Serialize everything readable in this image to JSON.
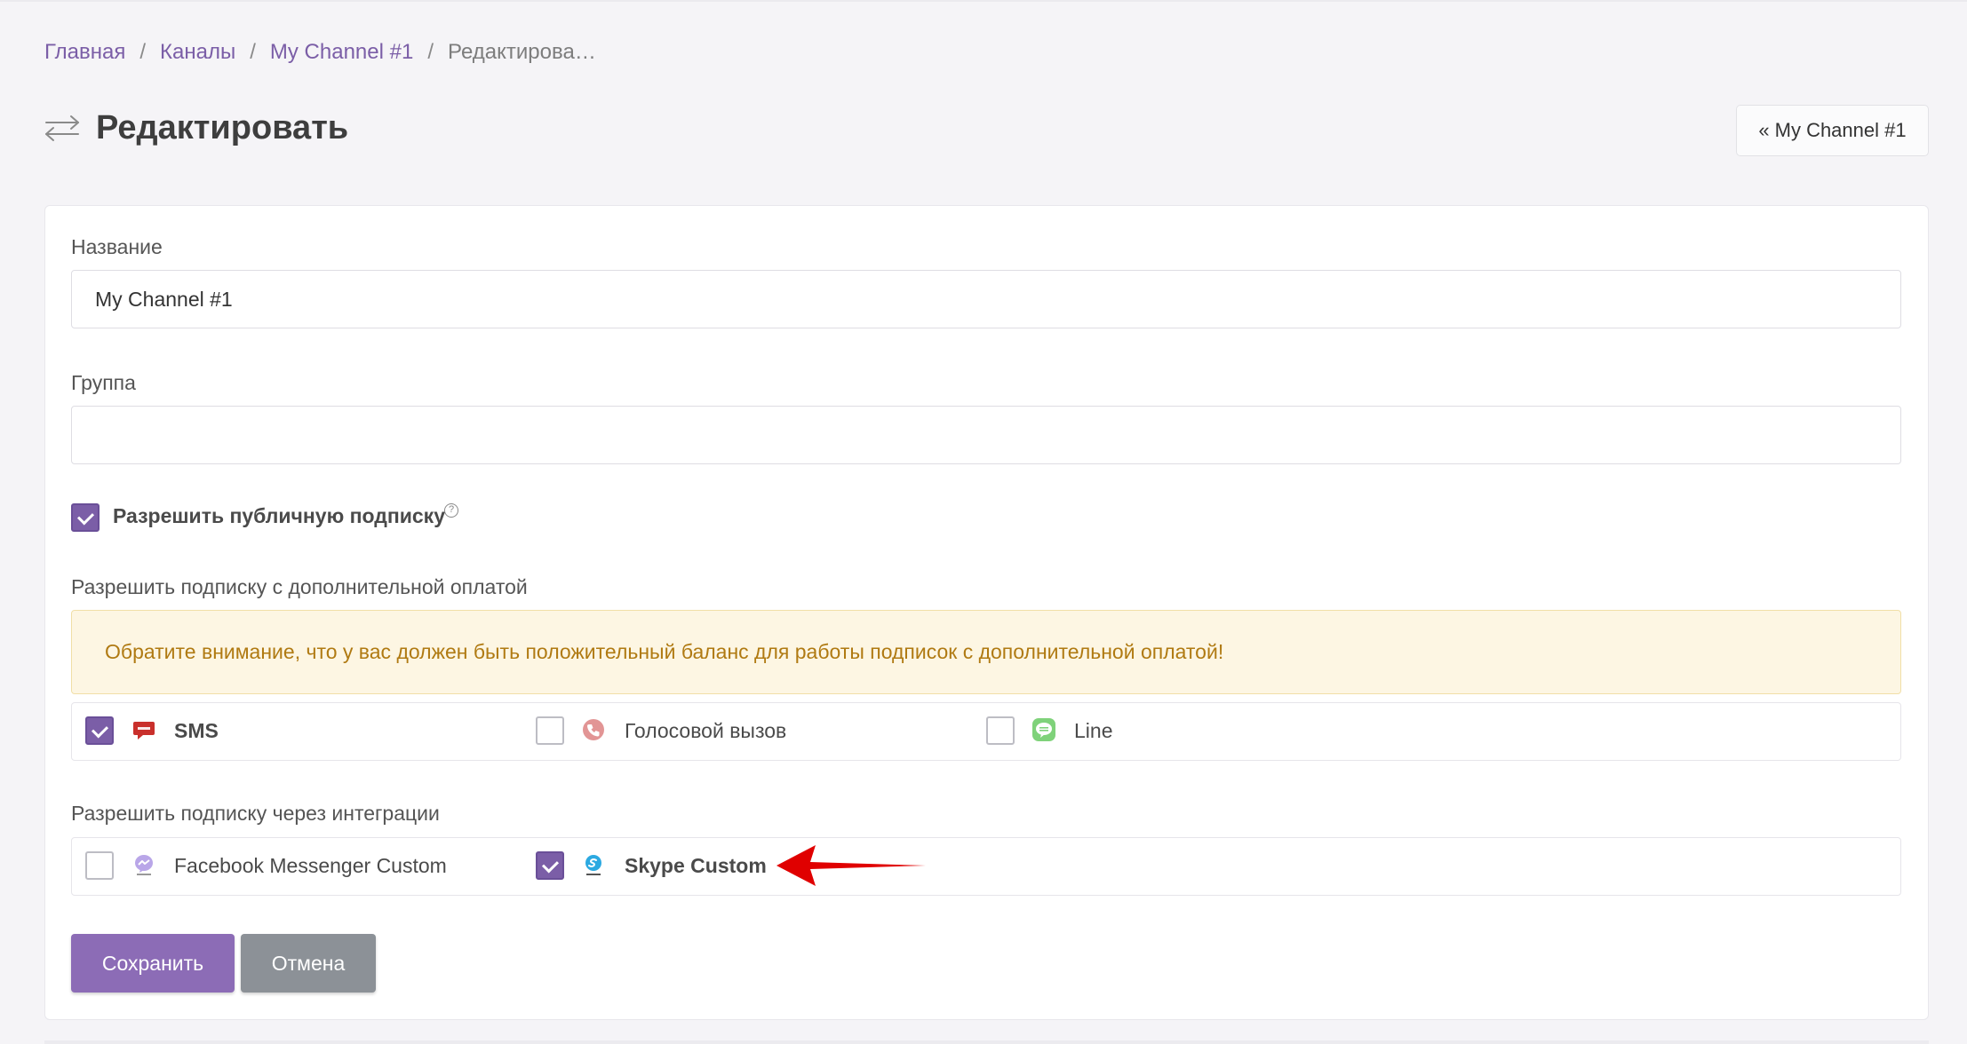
{
  "breadcrumb": {
    "items": [
      "Главная",
      "Каналы",
      "My Channel #1"
    ],
    "separator": "/",
    "current": "Редактирова…"
  },
  "header": {
    "icon": "exchange-arrows-icon",
    "title": "Редактировать",
    "back_chevron": "«",
    "back_label": "My Channel #1"
  },
  "form": {
    "name_label": "Название",
    "name_value": "My Channel #1",
    "group_label": "Группа",
    "group_value": "",
    "public_subscribe": {
      "label": "Разрешить публичную подписку",
      "checked": true,
      "help": "?"
    },
    "paid_section_label": "Разрешить подписку с дополнительной оплатой",
    "paid_alert": "Обратите внимание, что у вас должен быть положительный баланс для работы подписок с дополнительной оплатой!",
    "paid_options": [
      {
        "label": "SMS",
        "checked": true,
        "icon": "sms-icon"
      },
      {
        "label": "Голосовой вызов",
        "checked": false,
        "icon": "phone-call-icon"
      },
      {
        "label": "Line",
        "checked": false,
        "icon": "line-icon"
      }
    ],
    "integrations_label": "Разрешить подписку через интеграции",
    "integration_options": [
      {
        "label": "Facebook Messenger Custom",
        "checked": false,
        "icon": "messenger-icon"
      },
      {
        "label": "Skype Custom",
        "checked": true,
        "icon": "skype-icon"
      }
    ]
  },
  "actions": {
    "save_label": "Сохранить",
    "cancel_label": "Отмена"
  },
  "colors": {
    "accent": "#7b5ea7",
    "alert_text": "#b07a12",
    "alert_bg": "#fdf6e3",
    "annotation_arrow": "#e00000"
  }
}
